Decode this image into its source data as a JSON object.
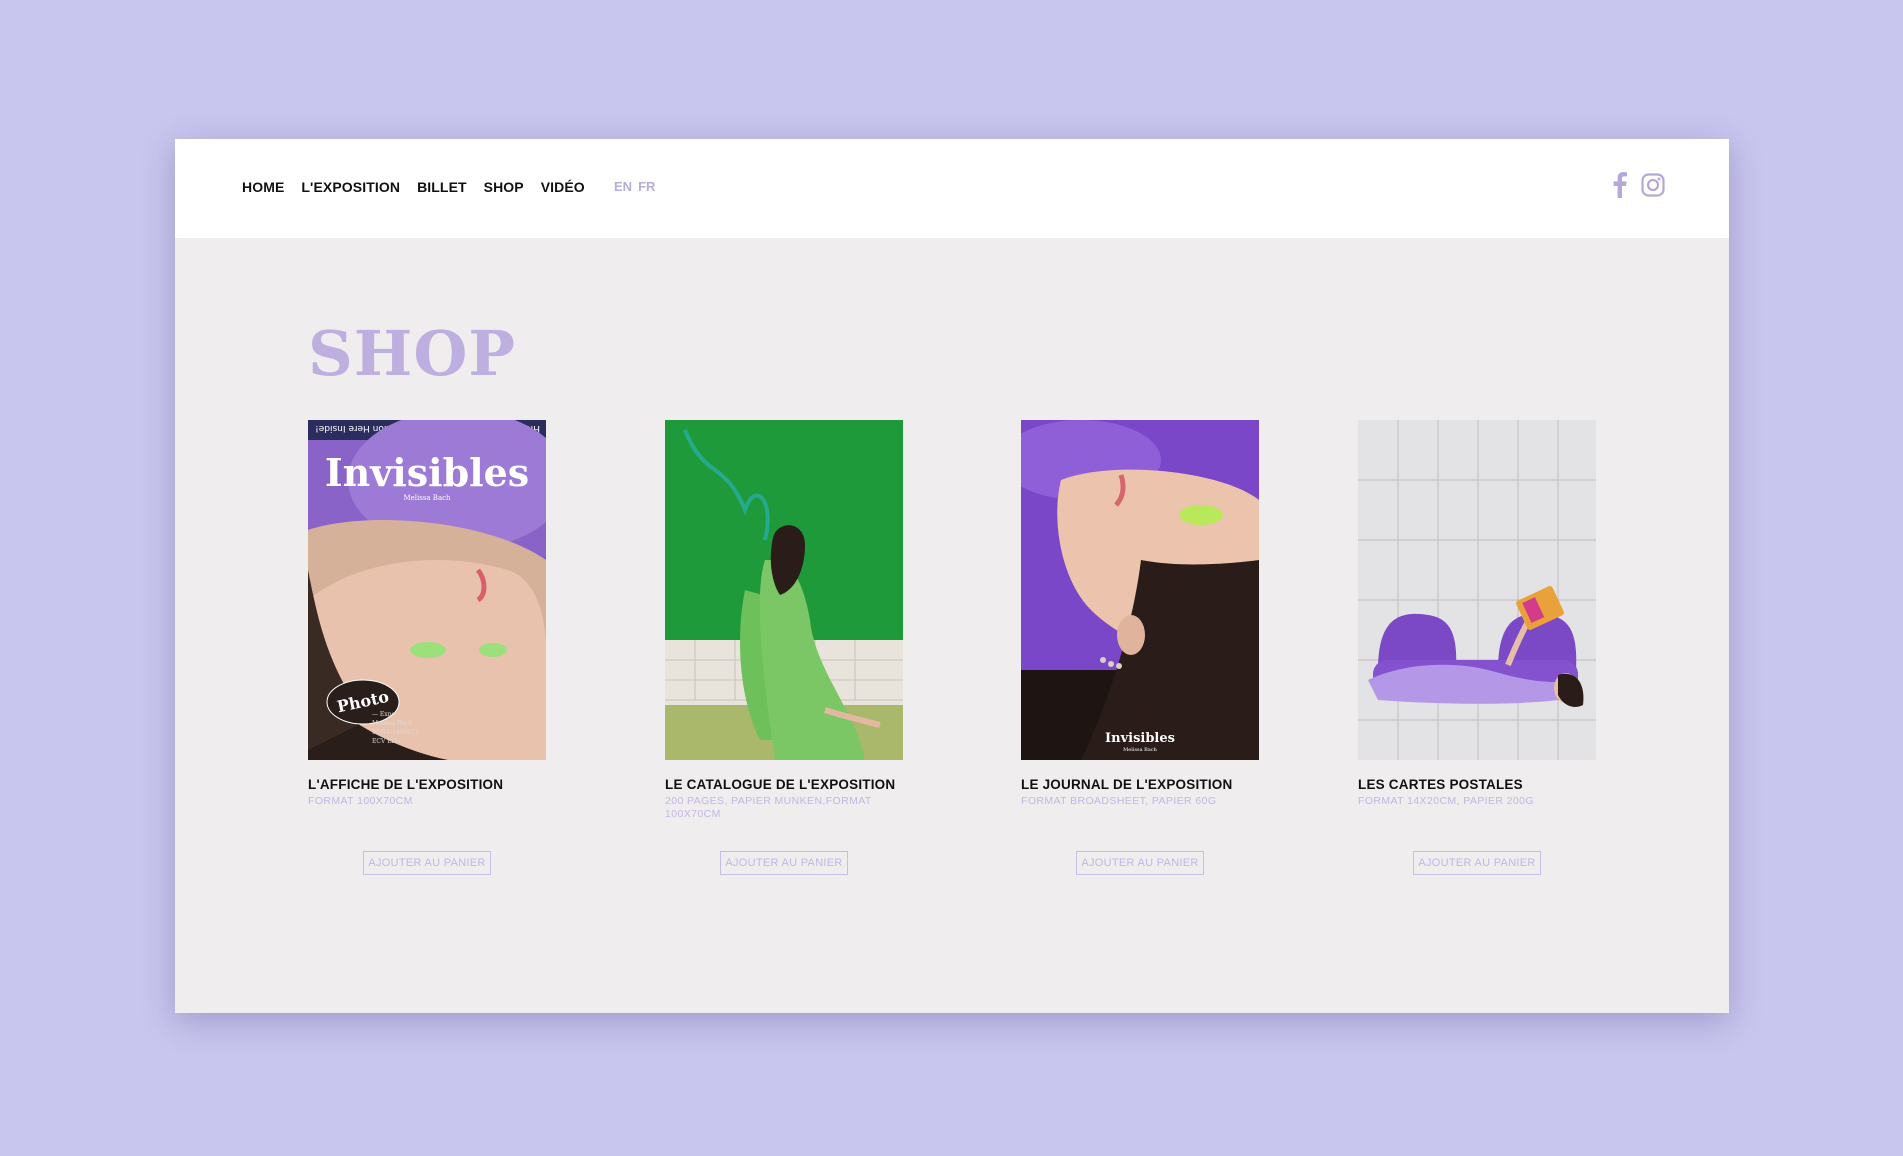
{
  "nav": {
    "items": [
      "HOME",
      "L'EXPOSITION",
      "BILLET",
      "SHOP",
      "VIDÉO"
    ],
    "lang": [
      "EN",
      "FR"
    ]
  },
  "social": {
    "icons": [
      "facebook-icon",
      "instagram-icon"
    ],
    "color": "#b4a9d6"
  },
  "page": {
    "title": "SHOP"
  },
  "products": [
    {
      "title": "L'AFFICHE DE L'EXPOSITION",
      "subtitle": "FORMAT 100X70CM",
      "button": "AJOUTER AU PANIER",
      "poster_title": "Invisibles",
      "poster_author": "Melissa Bach",
      "poster_badge": "Photo",
      "poster_details": [
        "— Expo",
        "Melissa Bach",
        "03/03–14/04/21",
        "ECV Lille"
      ],
      "poster_banner": "HN BIEBEL  Hey & Hair-Related Action Here Inside!"
    },
    {
      "title": "LE CATALOGUE DE L'EXPOSITION",
      "subtitle": "200 PAGES, PAPIER MUNKEN,FORMAT 100X70CM",
      "button": "AJOUTER AU PANIER"
    },
    {
      "title": "LE JOURNAL DE L'EXPOSITION",
      "subtitle": "FORMAT BROADSHEET, PAPIER 60G",
      "button": "AJOUTER AU PANIER",
      "poster_title": "Invisibles",
      "poster_author": "Melissa Bach"
    },
    {
      "title": "LES CARTES POSTALES",
      "subtitle": "FORMAT 14X20CM, PAPIER 200G",
      "button": "AJOUTER AU PANIER"
    }
  ],
  "colors": {
    "background": "#c8c5ee",
    "accent": "#bfaee0",
    "muted": "#c4b6e3"
  }
}
